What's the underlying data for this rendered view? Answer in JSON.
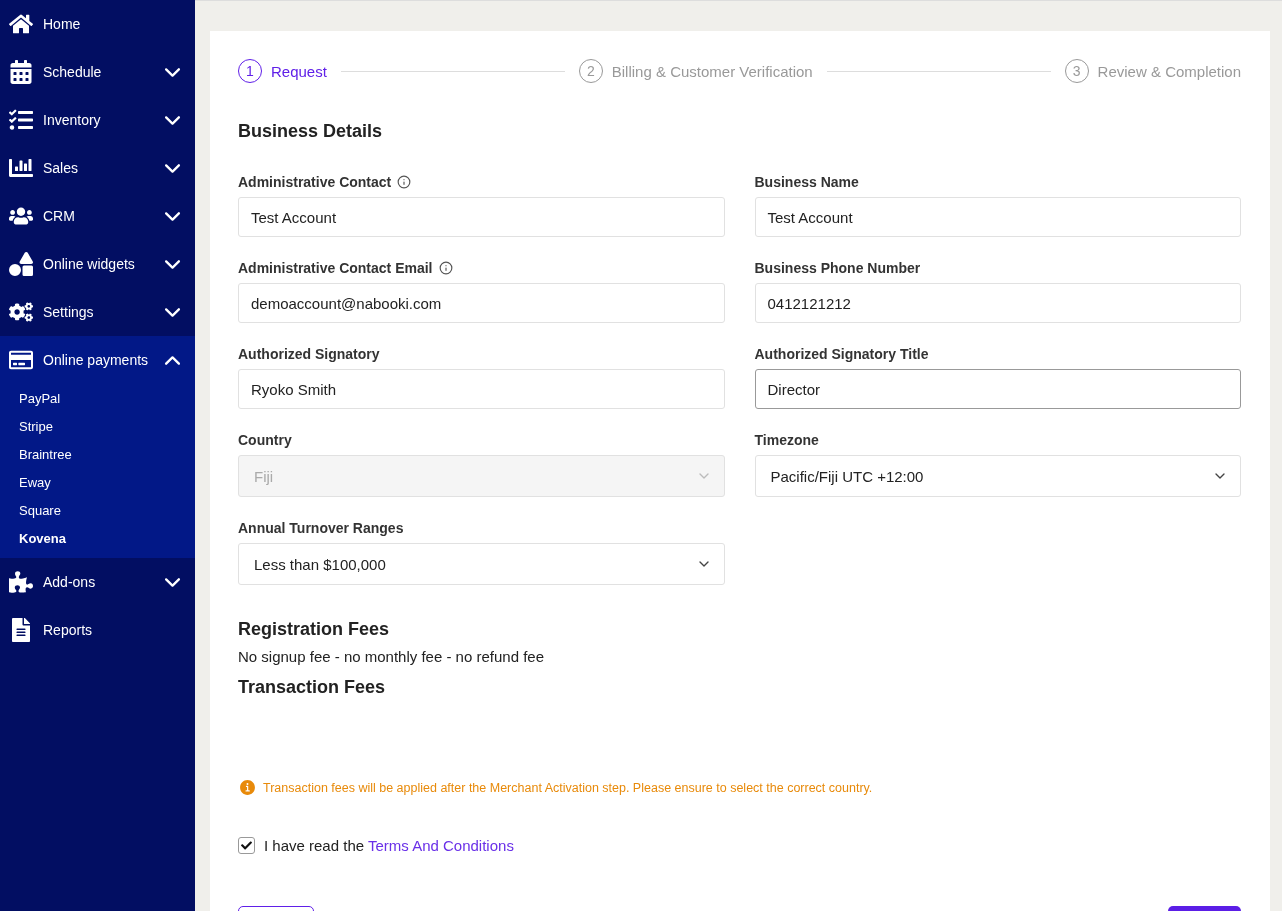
{
  "sidebar": {
    "items": [
      {
        "label": "Home"
      },
      {
        "label": "Schedule",
        "expanded": false
      },
      {
        "label": "Inventory",
        "expanded": false
      },
      {
        "label": "Sales",
        "expanded": false
      },
      {
        "label": "CRM",
        "expanded": false
      },
      {
        "label": "Online widgets",
        "expanded": false
      },
      {
        "label": "Settings",
        "expanded": false
      },
      {
        "label": "Online payments",
        "expanded": true,
        "children": [
          {
            "label": "PayPal",
            "selected": false
          },
          {
            "label": "Stripe",
            "selected": false
          },
          {
            "label": "Braintree",
            "selected": false
          },
          {
            "label": "Eway",
            "selected": false
          },
          {
            "label": "Square",
            "selected": false
          },
          {
            "label": "Kovena",
            "selected": true
          }
        ]
      },
      {
        "label": "Add-ons",
        "expanded": false
      },
      {
        "label": "Reports"
      }
    ]
  },
  "steps": [
    {
      "number": "1",
      "label": "Request",
      "selected": true
    },
    {
      "number": "2",
      "label": "Billing & Customer Verification",
      "selected": false
    },
    {
      "number": "3",
      "label": "Review & Completion",
      "selected": false
    }
  ],
  "business_details": {
    "title": "Business Details",
    "fields": [
      {
        "label": "Administrative Contact",
        "info": true,
        "kind": "text",
        "value": "Test Account",
        "focused": false,
        "disabled": false
      },
      {
        "label": "Business Name",
        "info": false,
        "kind": "text",
        "value": "Test Account",
        "focused": false,
        "disabled": false
      },
      {
        "label": "Administrative Contact Email",
        "info": true,
        "kind": "text",
        "value": "demoaccount@nabooki.com",
        "focused": false,
        "disabled": false
      },
      {
        "label": "Business Phone Number",
        "info": false,
        "kind": "text",
        "value": "0412121212",
        "focused": false,
        "disabled": false
      },
      {
        "label": "Authorized Signatory",
        "info": false,
        "kind": "text",
        "value": "Ryoko Smith",
        "focused": false,
        "disabled": false
      },
      {
        "label": "Authorized Signatory Title",
        "info": false,
        "kind": "text",
        "value": "Director",
        "focused": true,
        "disabled": false
      },
      {
        "label": "Country",
        "info": false,
        "kind": "select",
        "value": "Fiji",
        "focused": false,
        "disabled": true
      },
      {
        "label": "Timezone",
        "info": false,
        "kind": "select",
        "value": "Pacific/Fiji UTC +12:00",
        "focused": false,
        "disabled": false
      },
      {
        "label": "Annual Turnover Ranges",
        "info": false,
        "kind": "select",
        "value": "Less than $100,000",
        "focused": false,
        "disabled": false
      }
    ]
  },
  "registration_fees": {
    "title": "Registration Fees",
    "text": "No signup fee - no monthly fee - no refund fee"
  },
  "transaction_fees": {
    "title": "Transaction Fees",
    "notice": "Transaction fees will be applied after the Merchant Activation step. Please ensure to select the correct country."
  },
  "terms": {
    "checked": true,
    "text": "I have read the",
    "link": "Terms And Conditions"
  }
}
